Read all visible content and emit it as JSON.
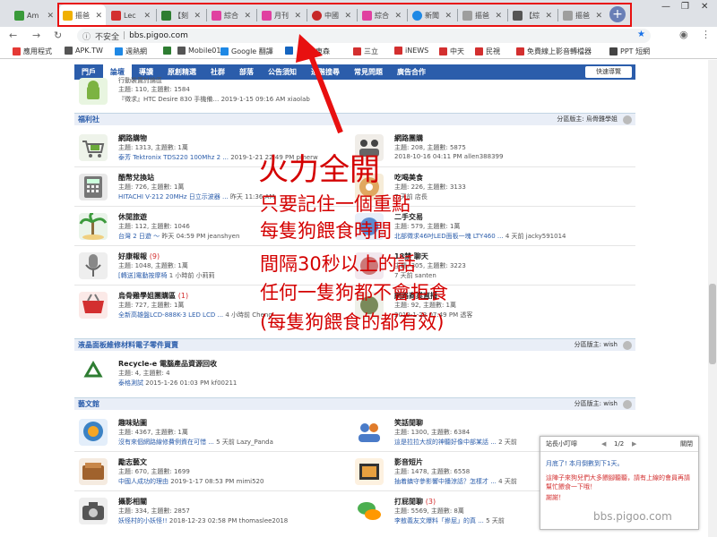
{
  "browser": {
    "tabs": [
      {
        "label": "Am",
        "fav": "#3a9a3a"
      },
      {
        "label": "摳爸",
        "fav": "#f0b000"
      },
      {
        "label": "Lec",
        "fav": "#d32f2f"
      },
      {
        "label": "【刻",
        "fav": "#2e7d32"
      },
      {
        "label": "綜合",
        "fav": "#e040a0"
      },
      {
        "label": "月刊",
        "fav": "#e040a0"
      },
      {
        "label": "中國",
        "fav": "#c62828"
      },
      {
        "label": "綜合",
        "fav": "#e040a0"
      },
      {
        "label": "新聞",
        "fav": "#1e88e5"
      },
      {
        "label": "摳爸",
        "fav": "#9e9e9e"
      },
      {
        "label": "【綜",
        "fav": "#555555"
      },
      {
        "label": "摳爸",
        "fav": "#9e9e9e"
      }
    ],
    "new_tab": "+",
    "address": {
      "secure_label": "不安全",
      "url": "bbs.pigoo.com"
    },
    "bookmarks": [
      {
        "label": "應用程式",
        "color": "#e53935"
      },
      {
        "label": "APK.TW",
        "color": "#555"
      },
      {
        "label": "週熱網",
        "color": "#1e88e5"
      },
      {
        "label": "",
        "color": "#2e7d32"
      },
      {
        "label": "Mobile01",
        "color": "#555"
      },
      {
        "label": "Google 翻譯",
        "color": "#1e88e5"
      },
      {
        "label": "",
        "color": "#1565c0"
      },
      {
        "label": "東森",
        "color": "#d32f2f"
      },
      {
        "label": "三立",
        "color": "#d32f2f"
      },
      {
        "label": "iNEWS",
        "color": "#d32f2f"
      },
      {
        "label": "中天",
        "color": "#d32f2f"
      },
      {
        "label": "民視",
        "color": "#d32f2f"
      },
      {
        "label": "免費線上影音轉檔器",
        "color": "#d32f2f"
      },
      {
        "label": "PPT 短網",
        "color": "#444"
      }
    ]
  },
  "forum_nav": {
    "items": [
      "門戶",
      "論壇",
      "導讀",
      "原創精選",
      "社群",
      "部落",
      "公告須知",
      "進階搜尋",
      "常見問題",
      "廣告合作"
    ],
    "quick_link": "快速導覽"
  },
  "top_partial": {
    "title": "行動裝置討論區",
    "stats": "主題: 110, 主題數: 1584",
    "last": "『徵求』HTC Desire 830 手機備…  2019-1-15 09:16 AM xiaolab"
  },
  "sections": [
    {
      "title": "福利社",
      "mod": "分區版主: 烏骨雞學姐"
    },
    {
      "title": "液晶面板維修材料電子零件買賣",
      "mod": "分區版主: wish"
    },
    {
      "title": "藝文館",
      "mod": "分區版主: wish"
    }
  ],
  "forums": {
    "f1": {
      "title": "網路購物",
      "stats": "主題: 1313, 主題數: 1萬",
      "link": "泰芳 Tektronix TDS220 100Mhz 2 ...",
      "time": "2019-1-21 22:49 PM pmerw"
    },
    "f2": {
      "title": "網路團購",
      "stats": "主題: 208, 主題數: 5875",
      "link": "",
      "time": "2018-10-16 04:11 PM allen388399"
    },
    "f3": {
      "title": "酷幣兌換站",
      "stats": "主題: 726, 主題數: 1萬",
      "link": "HITACHI V-212 20MHz 日立示波器 ...",
      "time": "昨天 11:36 AM"
    },
    "f4": {
      "title": "吃喝美食",
      "stats": "主題: 226, 主題數: 3133",
      "link": "",
      "time": "7 天前 店長"
    },
    "f5": {
      "title": "休閒旅遊",
      "stats": "主題: 112, 主題數: 1046",
      "link": "台灣 2 日遊 ～",
      "time": "昨天 04:59 PM jeanshyen"
    },
    "f6": {
      "title": "二手交易",
      "stats": "主題: 579, 主題數: 1萬",
      "link": "北部徵求46吋LED面板一塊 LTY460 ...",
      "time": "4 天前 jacky591014"
    },
    "f7": {
      "title": "好康報報",
      "stats": "主題: 1048, 主題數: 1萬",
      "link": "[轉送]電動按摩椅",
      "time": "1 小時前 小莉莉"
    },
    "f8": {
      "title": "18禁 聊天",
      "stats": "主題: 305, 主題數: 3223",
      "link": "",
      "time": "7 天前 santen"
    },
    "f9": {
      "title": "烏骨雞學姐團購區",
      "badge": "(1)",
      "stats": "主題: 727, 主題數: 1萬",
      "link": "全新高雄盤LCD-888K-3 LED LCD ...",
      "time": "4 小時前 Cheng"
    },
    "f10": {
      "title": "網路商業直播",
      "stats": "主題: 92, 主題數: 1萬",
      "link": "",
      "time": "2019-1-23 07:49 PM 透客"
    },
    "f11": {
      "title": "Recycle-e 電腦產品資源回收",
      "stats": "主題: 4, 主題數: 4",
      "link": "泰格測試",
      "time": "2015-1-26 01:03 PM kf00211"
    },
    "f12": {
      "title": "趣味貼圖",
      "stats": "主題: 4367, 主題數: 1萬",
      "link": "沒有來個網路線修費例資在可惜 ...",
      "time": "5 天前 Lazy_Panda"
    },
    "f13": {
      "title": "笑話閒聊",
      "stats": "主題: 1300, 主題數: 6384",
      "link": "這是拉拉大叔的神聽好像中部某話 ...",
      "time": "2 天前"
    },
    "f14": {
      "title": "勵志藝文",
      "stats": "主題: 670, 主題數: 1699",
      "link": "中國人成功的理由",
      "time": "2019-1-17 08:53 PM mimi520"
    },
    "f15": {
      "title": "影音短片",
      "stats": "主題: 1478, 主題數: 6558",
      "link": "抽着鎮守參影響中播涼話？怎樣才 ...",
      "time": "4 天前"
    },
    "f16": {
      "title": "攝影相關",
      "stats": "主題: 334, 主題數: 2857",
      "link": "妖怪村的小妖怪!!",
      "time": "2018-12-23 02:58 PM thomaslee2018"
    },
    "f17": {
      "title": "打屁閒聊",
      "badge": "(3)",
      "stats": "主題: 5569, 主題數: 8萬",
      "link": "李敖義友文爆料「摻屁」的真 ...",
      "time": "5 天前"
    }
  },
  "annotation": {
    "title": "火力全開",
    "lines": [
      "只要記住一個重點",
      "每隻狗餵食時間",
      "間隔30秒以上的話",
      "任何一隻狗都不會拒食",
      "(每隻狗餵食的都有效)"
    ]
  },
  "popup": {
    "title": "站長小叮嚀",
    "page": "1/2",
    "close": "關閉",
    "line1": "月底了! 本月倒數到下1天。",
    "line2": "這陣子來狗兒們大多餵腳聽聽，請有上線的會員再請幫忙餵食一下哦！",
    "line3": "謝謝！"
  },
  "watermark": "bbs.pigoo.com"
}
